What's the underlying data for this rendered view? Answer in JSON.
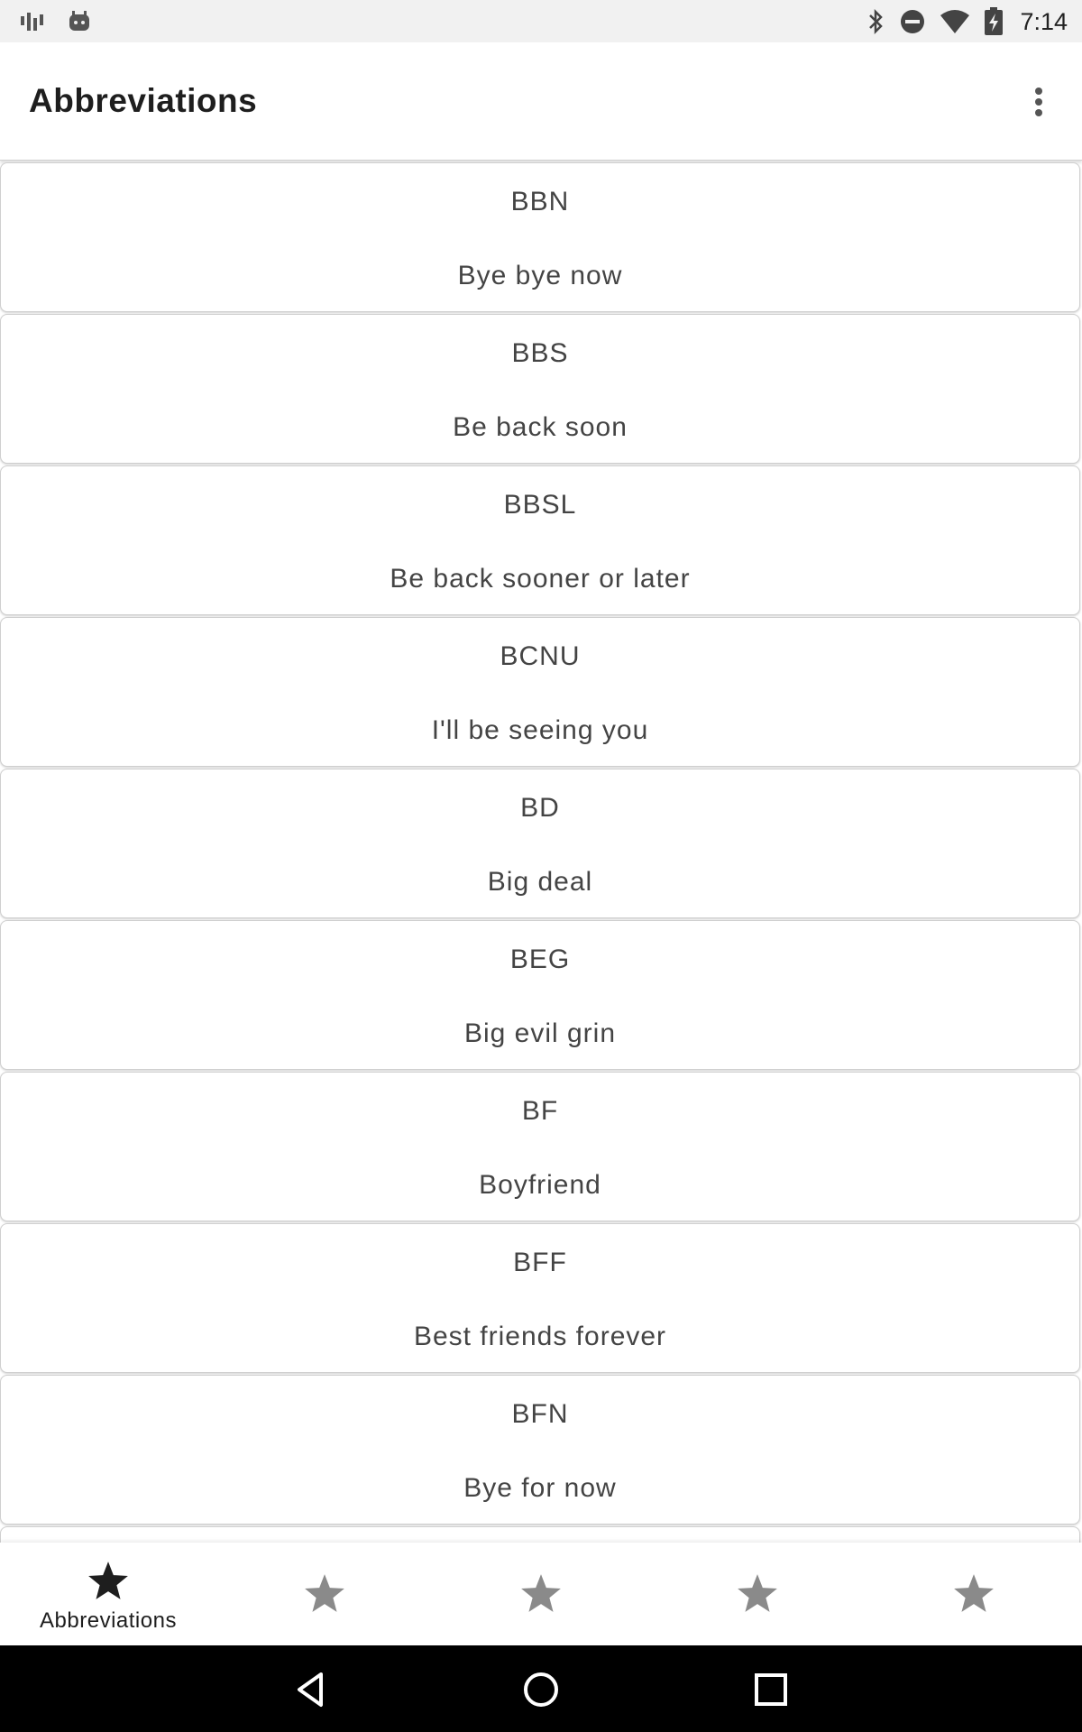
{
  "status_bar": {
    "time": "7:14",
    "left_icons": [
      "signal-bars-icon",
      "android-debug-icon"
    ],
    "right_icons": [
      "bluetooth-icon",
      "do-not-disturb-icon",
      "wifi-icon",
      "battery-charging-icon"
    ]
  },
  "app_bar": {
    "title": "Abbreviations",
    "menu_icon": "overflow-menu-icon"
  },
  "list": {
    "items": [
      {
        "abbr": "BBN",
        "meaning": "Bye bye now"
      },
      {
        "abbr": "BBS",
        "meaning": "Be back soon"
      },
      {
        "abbr": "BBSL",
        "meaning": "Be back sooner or later"
      },
      {
        "abbr": "BCNU",
        "meaning": "I'll be seeing you"
      },
      {
        "abbr": "BD",
        "meaning": "Big deal"
      },
      {
        "abbr": "BEG",
        "meaning": "Big evil grin"
      },
      {
        "abbr": "BF",
        "meaning": "Boyfriend"
      },
      {
        "abbr": "BFF",
        "meaning": "Best friends forever"
      },
      {
        "abbr": "BFN",
        "meaning": "Bye for now"
      }
    ]
  },
  "bottom_nav": {
    "items": [
      {
        "label": "Abbreviations",
        "icon": "star-icon",
        "active": true
      },
      {
        "label": "",
        "icon": "star-icon",
        "active": false
      },
      {
        "label": "",
        "icon": "star-icon",
        "active": false
      },
      {
        "label": "",
        "icon": "star-icon",
        "active": false
      },
      {
        "label": "",
        "icon": "star-icon",
        "active": false
      }
    ],
    "active_color": "#1e1e1e",
    "inactive_color": "#8a8a8a"
  },
  "system_nav": {
    "buttons": [
      "back-icon",
      "home-icon",
      "recents-icon"
    ]
  }
}
